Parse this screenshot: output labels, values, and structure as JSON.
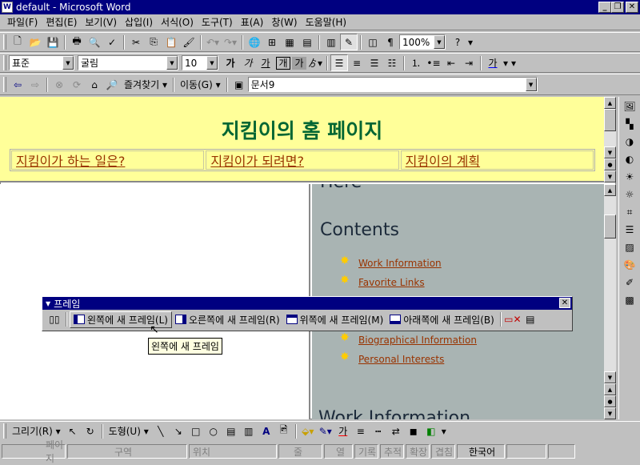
{
  "window": {
    "title": "default - Microsoft Word",
    "icon_label": "W"
  },
  "menu": [
    "파일(F)",
    "편집(E)",
    "보기(V)",
    "삽입(I)",
    "서식(O)",
    "도구(T)",
    "표(A)",
    "창(W)",
    "도움말(H)"
  ],
  "standard_toolbar": {
    "zoom": "100%"
  },
  "format_toolbar": {
    "style": "표준",
    "font": "굴림",
    "size": "10",
    "bold": "가",
    "italic": "가",
    "underline": "가",
    "char_border": "개",
    "char_shade": "가",
    "font_color": "가"
  },
  "web_toolbar": {
    "favorites": "즐겨찾기",
    "go": "이동(G)",
    "address": "문서9"
  },
  "top_frame": {
    "title": "지킴이의 홈 페이지",
    "links": [
      "지킴이가 하는 일은?",
      "지킴이가 되려면?",
      "지킴이의 계획"
    ]
  },
  "right_frame": {
    "partial_heading": "Here",
    "contents_heading": "Contents",
    "links": [
      "Work Information",
      "Favorite Links",
      "Biographical Information",
      "Personal Interests"
    ],
    "bottom_heading": "Work Information"
  },
  "frames_toolbar": {
    "title": "프레임",
    "buttons": [
      "왼쪽에 새 프레임(L)",
      "오른쪽에 새 프레임(R)",
      "위쪽에 새 프레임(M)",
      "아래쪽에 새 프레임(B)"
    ]
  },
  "tooltip": "왼쪽에 새 프레임",
  "drawing_toolbar": {
    "draw": "그리기(R)",
    "autoshapes": "도형(U)",
    "font_color": "가"
  },
  "status_bar": {
    "page": "페이지",
    "section": "구역",
    "position": "위치",
    "line": "줄",
    "column": "열",
    "rec": "기록",
    "trk": "추적",
    "ext": "확장",
    "ovr": "겹침",
    "language": "한국어"
  },
  "colors": {
    "title_bar": "#000080",
    "top_frame_bg": "#ffff99",
    "top_title": "#006633",
    "link": "#993300"
  }
}
